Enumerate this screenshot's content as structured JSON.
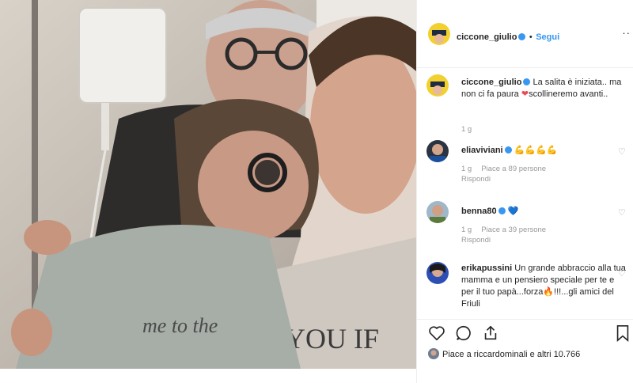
{
  "header": {
    "username": "ciccone_giulio",
    "follow_label": "Segui",
    "more_label": "··"
  },
  "caption": {
    "username": "ciccone_giulio",
    "text_before": "La salita è iniziata.. ma non ci fa paura ",
    "heart": "❤",
    "text_after": "scollineremo avanti..",
    "age": "1 g"
  },
  "comments": [
    {
      "username": "eliaviviani",
      "text": "💪💪💪💪",
      "age": "1 g",
      "likes": "Piace a 89 persone",
      "reply": "Rispondi"
    },
    {
      "username": "benna80",
      "text": "💙",
      "age": "1 g",
      "likes": "Piace a 39 persone",
      "reply": "Rispondi"
    },
    {
      "username": "erikapussini",
      "text": "Un grande abbraccio alla tua mamma e un pensiero speciale per te e per il tuo papà...forza🔥!!!...gli amici del Friuli"
    }
  ],
  "likes_summary": "Piace a riccardominali e altri 10.766",
  "icons": [
    "heart-icon",
    "comment-icon",
    "share-icon",
    "bookmark-icon",
    "verified-badge-icon",
    "ellipsis-icon"
  ],
  "colors": {
    "accent": "#3897f0",
    "text": "#262626",
    "muted": "#999999",
    "heart": "#ed4956",
    "border": "#efefef"
  }
}
